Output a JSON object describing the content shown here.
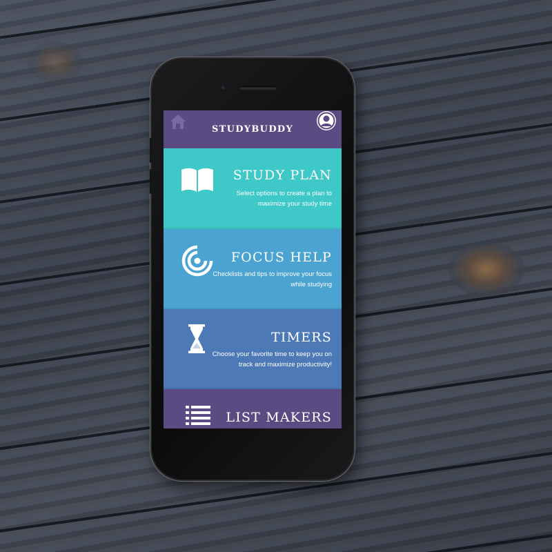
{
  "app": {
    "title": "STUDYBUDDY",
    "header_left_icon": "home-icon",
    "header_right_icon": "profile-icon"
  },
  "menu": [
    {
      "title": "STUDY PLAN",
      "description": "Select options to create a plan to maximize your study time",
      "icon": "open-book-icon",
      "color": "#3ec8c8"
    },
    {
      "title": "FOCUS HELP",
      "description": "Checklists and tips to improve your focus while studying",
      "icon": "target-icon",
      "color": "#4aa3d1"
    },
    {
      "title": "TIMERS",
      "description": "Choose your favorite time to keep you on track and maximize productivity!",
      "icon": "hourglass-icon",
      "color": "#4d7ab6"
    },
    {
      "title": "LIST MAKERS",
      "description": "",
      "icon": "list-icon",
      "color": "#5b4b83"
    }
  ],
  "colors": {
    "header": "#5b4b83",
    "text": "#ffffff"
  }
}
